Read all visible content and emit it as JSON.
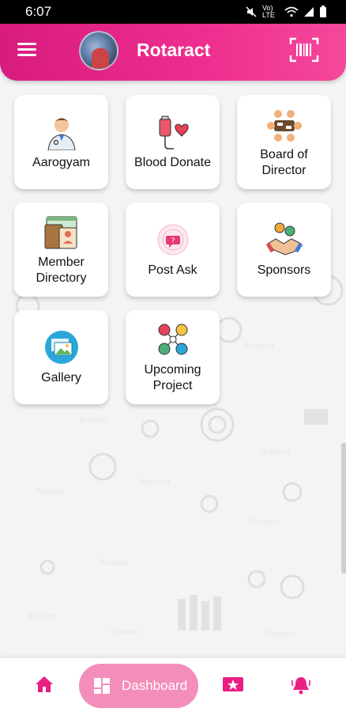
{
  "status_bar": {
    "time": "6:07",
    "network_label": "Vo) LTE"
  },
  "header": {
    "title": "Rotaract"
  },
  "tiles": [
    {
      "label": "Aarogyam",
      "icon": "doctor-icon"
    },
    {
      "label": "Blood Donate",
      "icon": "blood-donation-icon"
    },
    {
      "label": "Board of\nDirector",
      "icon": "board-meeting-icon"
    },
    {
      "label": "Member\nDirectory",
      "icon": "member-directory-icon"
    },
    {
      "label": "Post Ask",
      "icon": "post-ask-icon"
    },
    {
      "label": "Sponsors",
      "icon": "handshake-icon"
    },
    {
      "label": "Gallery",
      "icon": "gallery-icon"
    },
    {
      "label": "Upcoming\nProject",
      "icon": "project-network-icon"
    }
  ],
  "bottom_nav": {
    "dashboard_label": "Dashboard",
    "items": [
      "home-icon",
      "dashboard-icon",
      "star-ticket-icon",
      "bell-icon"
    ]
  },
  "colors": {
    "primary": "#e91e83",
    "pill": "#f38db9",
    "background": "#f4f4f4"
  }
}
